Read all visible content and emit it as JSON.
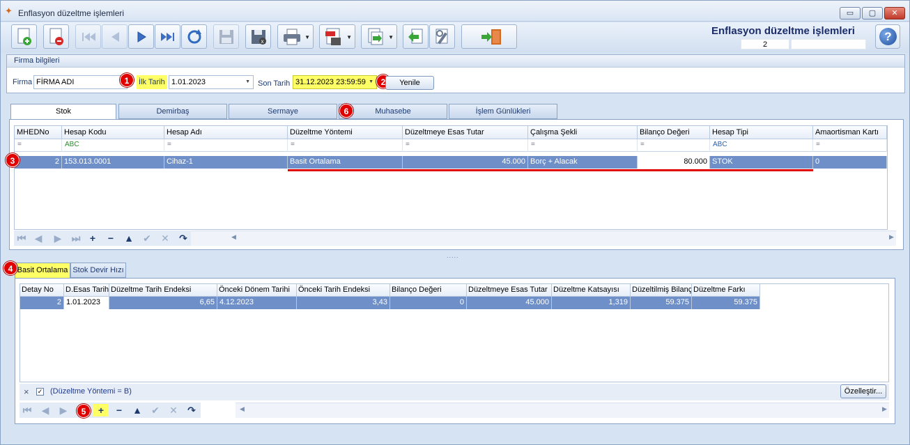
{
  "window": {
    "title": "Enflasyon düzeltme işlemleri",
    "min": "▭",
    "max": "▢",
    "close": "✕"
  },
  "toolbar": {
    "buttons": [
      "new-record",
      "delete-record",
      "first",
      "prev",
      "next",
      "last",
      "refresh",
      "save",
      "cancel-save",
      "print",
      "pdf-export",
      "excel-export",
      "import",
      "tools",
      "exit"
    ],
    "form_title": "Enflasyon düzeltme işlemleri",
    "record_count": "2",
    "help": "?"
  },
  "firma": {
    "header": "Firma bilgileri",
    "firma_label": "Firma",
    "firma_value": "FİRMA ADI",
    "ilk_tarih_label": "İlk Tarih",
    "ilk_tarih_value": "1.01.2023",
    "son_tarih_label": "Son Tarih",
    "son_tarih_value": "31.12.2023 23:59:59",
    "yenile": "Yenile"
  },
  "badges": [
    "1",
    "2",
    "3",
    "4",
    "5",
    "6"
  ],
  "top_tabs": [
    "Stok",
    "Demirbaş",
    "Sermaye",
    "Muhasebe",
    "İşlem Günlükleri"
  ],
  "main_grid": {
    "columns": [
      "MHEDNo",
      "Hesap Kodu",
      "Hesap Adı",
      "Düzeltme Yöntemi",
      "Düzeltmeye Esas Tutar",
      "Çalışma Şekli",
      "Bilanço Değeri",
      "Hesap Tipi",
      "Amaortisman Kartı"
    ],
    "filters": [
      "=",
      "ABC",
      "=",
      "=",
      "=",
      "=",
      "=",
      "ABC",
      "="
    ],
    "row": [
      "2",
      "153.013.0001",
      "Cihaz-1",
      "Basit Ortalama",
      "45.000",
      "Borç + Alacak",
      "80.000",
      "STOK",
      "0"
    ]
  },
  "bottom_tabs": [
    "Basit Ortalama",
    "Stok Devir Hızı"
  ],
  "detail_grid": {
    "columns": [
      "Detay No",
      "D.Esas Tarih",
      "Düzeltme Tarih Endeksi",
      "Önceki Dönem Tarihi",
      "Önceki Tarih Endeksi",
      "Bilanço Değeri",
      "Düzeltmeye Esas Tutar",
      "Düzeltme Katsayısı",
      "Düzeltilmiş Bilanço",
      "Düzeltme Farkı"
    ],
    "row": [
      "2",
      "1.01.2023",
      "6,65",
      "4.12.2023",
      "3,43",
      "0",
      "45.000",
      "1,319",
      "59.375",
      "59.375"
    ]
  },
  "filter_text": "(Düzeltme Yöntemi = B)",
  "filter_close": "×",
  "filter_check": "✓",
  "ozellestir": "Özelleştir...",
  "nav": {
    "first": "⏮",
    "prev": "◀",
    "next": "▶",
    "last": "⏭",
    "add": "+",
    "remove": "−",
    "up": "▲",
    "ok": "✔",
    "cancel": "✕",
    "redo": "↷"
  },
  "scroll": {
    "left": "◀",
    "right": "▶"
  },
  "splitter": ".....",
  "colors": {
    "accent": "#6e8fc8",
    "highlight": "#ffff66",
    "badge": "#e00000",
    "title": "#1b2c6b"
  }
}
